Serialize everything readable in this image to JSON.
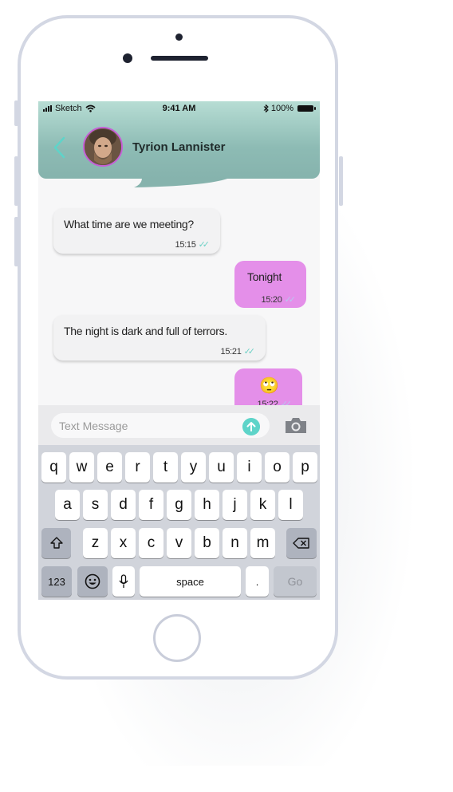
{
  "status_bar": {
    "carrier": "Sketch",
    "time": "9:41 AM",
    "battery": "100%"
  },
  "chat": {
    "contact_name": "Tyrion Lannister"
  },
  "messages": [
    {
      "direction": "incoming",
      "text": "What time are we meeting?",
      "time": "15:15"
    },
    {
      "direction": "outgoing",
      "text": "Tonight",
      "time": "15:20"
    },
    {
      "direction": "incoming",
      "text": "The night is dark and full of terrors.",
      "time": "15:21"
    },
    {
      "direction": "outgoing",
      "text": "🙄",
      "time": "15:22"
    }
  ],
  "composer": {
    "placeholder": "Text Message"
  },
  "keyboard": {
    "row1": [
      "q",
      "w",
      "e",
      "r",
      "t",
      "y",
      "u",
      "i",
      "o",
      "p"
    ],
    "row2": [
      "a",
      "s",
      "d",
      "f",
      "g",
      "h",
      "j",
      "k",
      "l"
    ],
    "row3": [
      "z",
      "x",
      "c",
      "v",
      "b",
      "n",
      "m"
    ],
    "numbers_key": "123",
    "space_key": "space",
    "period_key": ".",
    "go_key": "Go"
  },
  "colors": {
    "header": "#8dbbb4",
    "outgoing_bubble": "#e48fe9",
    "accent": "#5ed4c9",
    "phone_frame": "#d3d7e3"
  },
  "icons": [
    "signal-icon",
    "wifi-icon",
    "bluetooth-icon",
    "battery-icon",
    "back-chevron-icon",
    "send-arrow-icon",
    "camera-icon",
    "shift-icon",
    "delete-icon",
    "emoji-icon",
    "microphone-icon"
  ]
}
